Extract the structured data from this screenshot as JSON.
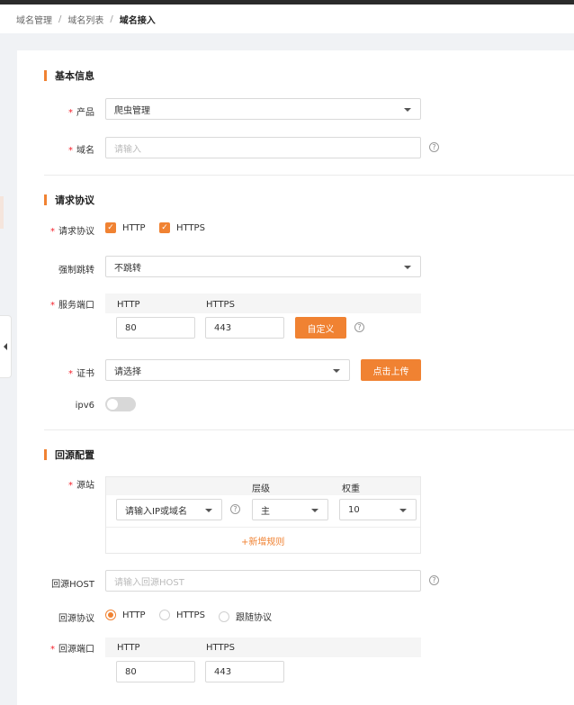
{
  "breadcrumb": [
    "域名管理",
    "域名列表",
    "域名接入"
  ],
  "sections": {
    "basic": "基本信息",
    "protocol": "请求协议",
    "origin": "回源配置"
  },
  "basic": {
    "product_label": "产品",
    "product_value": "爬虫管理",
    "domain_label": "域名",
    "domain_placeholder": "请输入"
  },
  "protocol": {
    "req_label": "请求协议",
    "http": "HTTP",
    "https": "HTTPS",
    "redirect_label": "强制跳转",
    "redirect_value": "不跳转",
    "port_label": "服务端口",
    "port_head_http": "HTTP",
    "port_head_https": "HTTPS",
    "port_http": "80",
    "port_https": "443",
    "custom_btn": "自定义",
    "cert_label": "证书",
    "cert_value": "请选择",
    "upload_btn": "点击上传",
    "ipv6_label": "ipv6"
  },
  "origin": {
    "site_label": "源站",
    "level_head": "层级",
    "weight_head": "权重",
    "ip_value": "请输入IP或域名",
    "level_value": "主",
    "weight_value": "10",
    "add_rule": "+新增规则",
    "host_label": "回源HOST",
    "host_placeholder": "请输入回源HOST",
    "proto_label": "回源协议",
    "proto_http": "HTTP",
    "proto_https": "HTTPS",
    "proto_follow": "跟随协议",
    "port_label": "回源端口",
    "port_head_http": "HTTP",
    "port_head_https": "HTTPS",
    "port_http": "80",
    "port_https": "443"
  },
  "colors": {
    "accent": "#f08232",
    "required": "#f5222d"
  }
}
